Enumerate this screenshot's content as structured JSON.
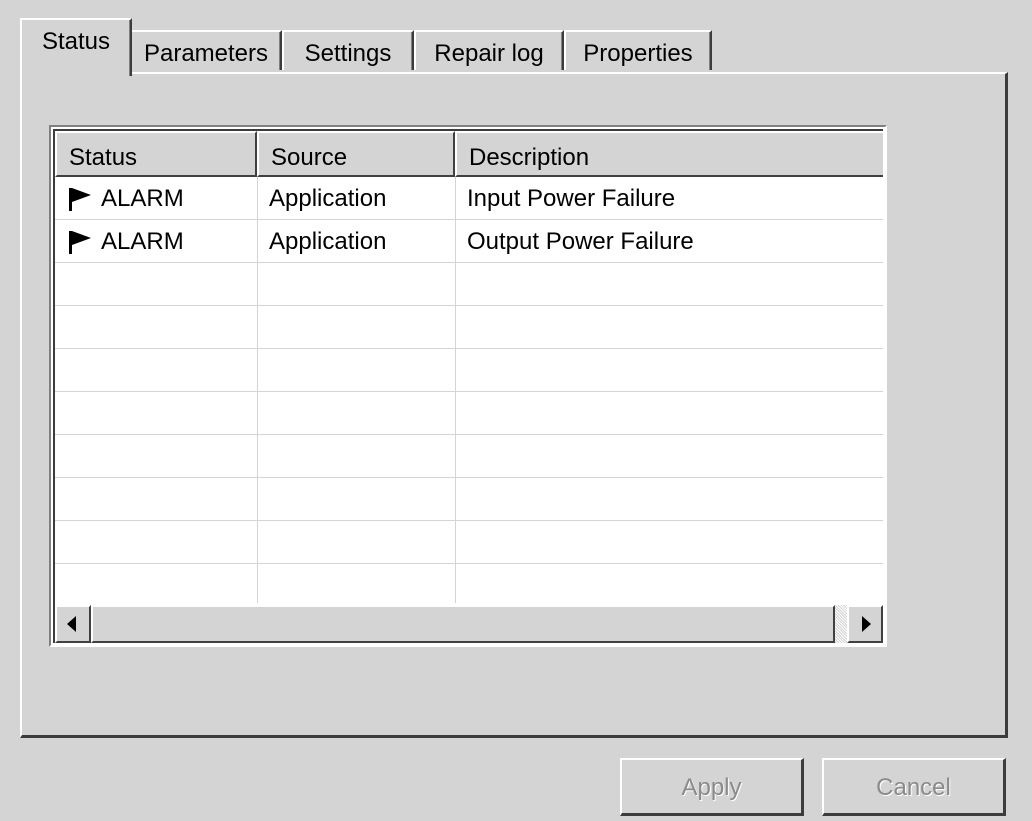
{
  "tabs": [
    {
      "label": "Status",
      "active": true
    },
    {
      "label": "Parameters",
      "active": false
    },
    {
      "label": "Settings",
      "active": false
    },
    {
      "label": "Repair log",
      "active": false
    },
    {
      "label": "Properties",
      "active": false
    }
  ],
  "table": {
    "columns": [
      "Status",
      "Source",
      "Description"
    ],
    "rows": [
      {
        "status": "ALARM",
        "icon": "flag-icon",
        "source": "Application",
        "description": "Input Power Failure"
      },
      {
        "status": "ALARM",
        "icon": "flag-icon",
        "source": "Application",
        "description": "Output Power Failure"
      }
    ]
  },
  "buttons": {
    "apply": "Apply",
    "cancel": "Cancel",
    "apply_enabled": false,
    "cancel_enabled": false
  }
}
